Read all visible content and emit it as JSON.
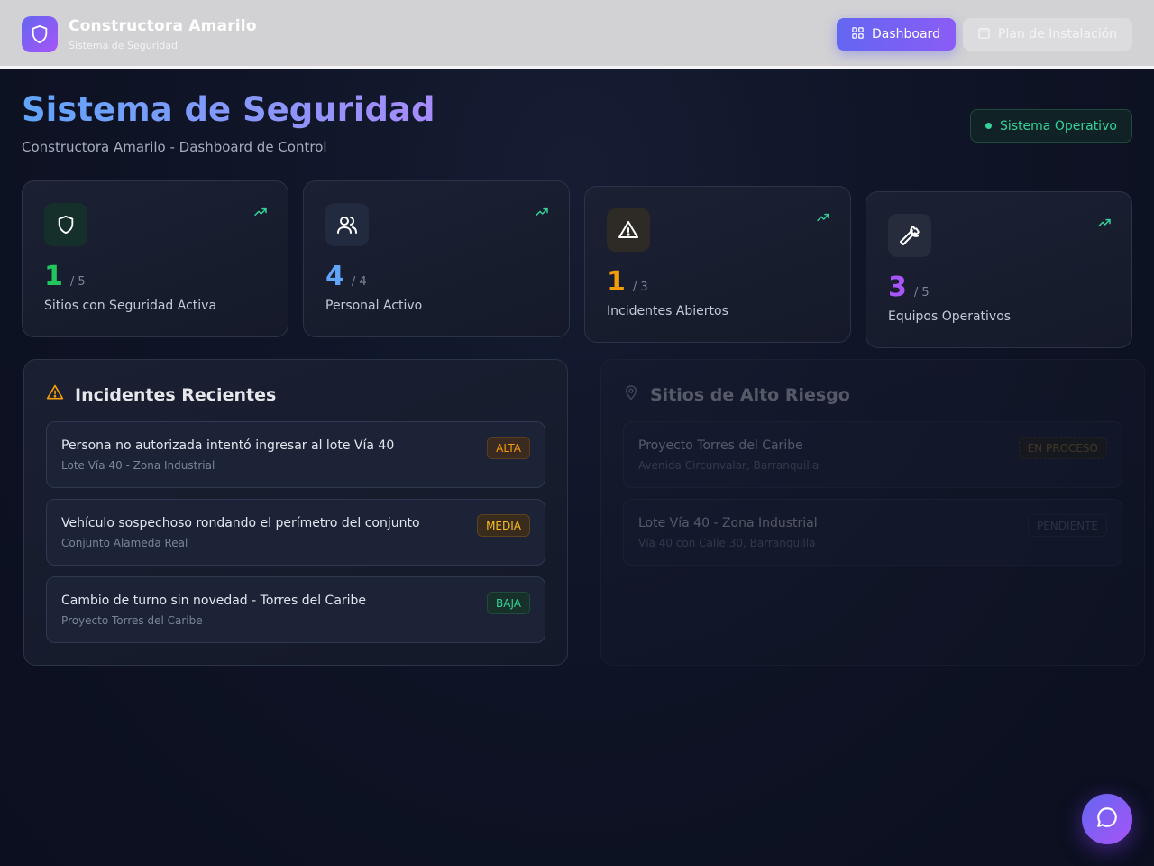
{
  "header": {
    "brand_name": "Constructora Amarilo",
    "brand_sub": "Sistema de Seguridad",
    "nav": [
      {
        "label": "Dashboard",
        "icon": "grid-icon",
        "active": true
      },
      {
        "label": "Plan de Instalación",
        "icon": "calendar-icon",
        "active": false
      }
    ]
  },
  "page": {
    "title": "Sistema de Seguridad",
    "subtitle": "Constructora Amarilo - Dashboard de Control",
    "status": "Sistema Operativo"
  },
  "stats": [
    {
      "value": "1",
      "total": "/ 5",
      "label": "Sitios con Seguridad Activa",
      "icon": "shield-icon",
      "color": "#22c55e"
    },
    {
      "value": "4",
      "total": "/ 4",
      "label": "Personal Activo",
      "icon": "users-icon",
      "color": "#60a5fa"
    },
    {
      "value": "1",
      "total": "/ 3",
      "label": "Incidentes Abiertos",
      "icon": "alert-triangle-icon",
      "color": "#f59e0b"
    },
    {
      "value": "3",
      "total": "/ 5",
      "label": "Equipos Operativos",
      "icon": "wrench-icon",
      "color": "#a855f7"
    }
  ],
  "incidents": {
    "title": "Incidentes Recientes",
    "items": [
      {
        "title": "Persona no autorizada intentó ingresar al lote Vía 40",
        "location": "Lote Vía 40 - Zona Industrial",
        "severity": "ALTA"
      },
      {
        "title": "Vehículo sospechoso rondando el perímetro del conjunto",
        "location": "Conjunto Alameda Real",
        "severity": "MEDIA"
      },
      {
        "title": "Cambio de turno sin novedad - Torres del Caribe",
        "location": "Proyecto Torres del Caribe",
        "severity": "BAJA"
      }
    ]
  },
  "risk_sites": {
    "title": "Sitios de Alto Riesgo",
    "items": [
      {
        "name": "Proyecto Torres del Caribe",
        "address": "Avenida Circunvalar, Barranquilla",
        "status": "EN PROCESO"
      },
      {
        "name": "Lote Vía 40 - Zona Industrial",
        "address": "Vía 40 con Calle 30, Barranquilla",
        "status": "PENDIENTE"
      }
    ]
  },
  "colors": {
    "accent": "#6366f1",
    "accent2": "#a855f7",
    "success": "#34d399",
    "warning": "#f59e0b"
  }
}
